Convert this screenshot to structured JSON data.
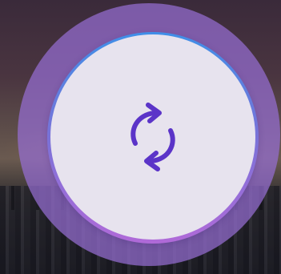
{
  "background": {
    "scene": "city-skyline-dusk"
  },
  "sync_button": {
    "icon": "sync-icon",
    "icon_color": "#5b34c8",
    "ring_gradient_top": "#3f8fe8",
    "ring_gradient_bottom": "#b06ad8",
    "halo_color": "#966ed2",
    "face_color": "#e7e3ee"
  }
}
